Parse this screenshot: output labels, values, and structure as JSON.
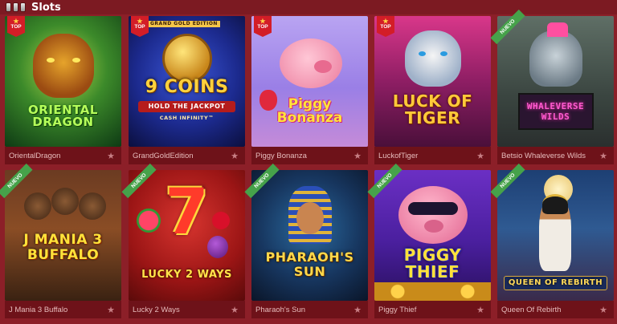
{
  "header": {
    "title": "Slots",
    "icon": "slot-machine-icon"
  },
  "badges": {
    "top": "TOP",
    "new": "NUEVO"
  },
  "games": [
    {
      "name": "OrientalDragon",
      "art_title": "ORIENTAL DRAGON",
      "badge": "top"
    },
    {
      "name": "GrandGoldEdition",
      "art_title": "9 COINS",
      "art_sub": "HOLD THE JACKPOT",
      "art_sub2": "CASH INFINITY™",
      "art_corner": "GRAND GOLD EDITION",
      "badge": "top"
    },
    {
      "name": "Piggy Bonanza",
      "art_title": "Piggy Bonanza",
      "badge": "top"
    },
    {
      "name": "LuckofTiger",
      "art_title": "LUCK OF TIGER",
      "badge": "top"
    },
    {
      "name": "Betsio Whaleverse Wilds",
      "art_title": "WHALEVERSE WILDS",
      "badge": "new"
    },
    {
      "name": "J Mania 3 Buffalo",
      "art_title": "J MANIA 3 BUFFALO",
      "badge": "new"
    },
    {
      "name": "Lucky 2 Ways",
      "art_title": "LUCKY 2 WAYS",
      "art_big": "7",
      "badge": "new"
    },
    {
      "name": "Pharaoh's Sun",
      "art_title": "PHARAOH'S SUN",
      "badge": "new"
    },
    {
      "name": "Piggy Thief",
      "art_title": "PIGGY THIEF",
      "badge": "new"
    },
    {
      "name": "Queen Of Rebirth",
      "art_title": "QUEEN OF REBIRTH",
      "badge": "new"
    }
  ],
  "colors": {
    "background": "#8c1f28",
    "caption": "#6e1219",
    "top_badge": "#d31d27",
    "new_badge": "#46a24a"
  }
}
